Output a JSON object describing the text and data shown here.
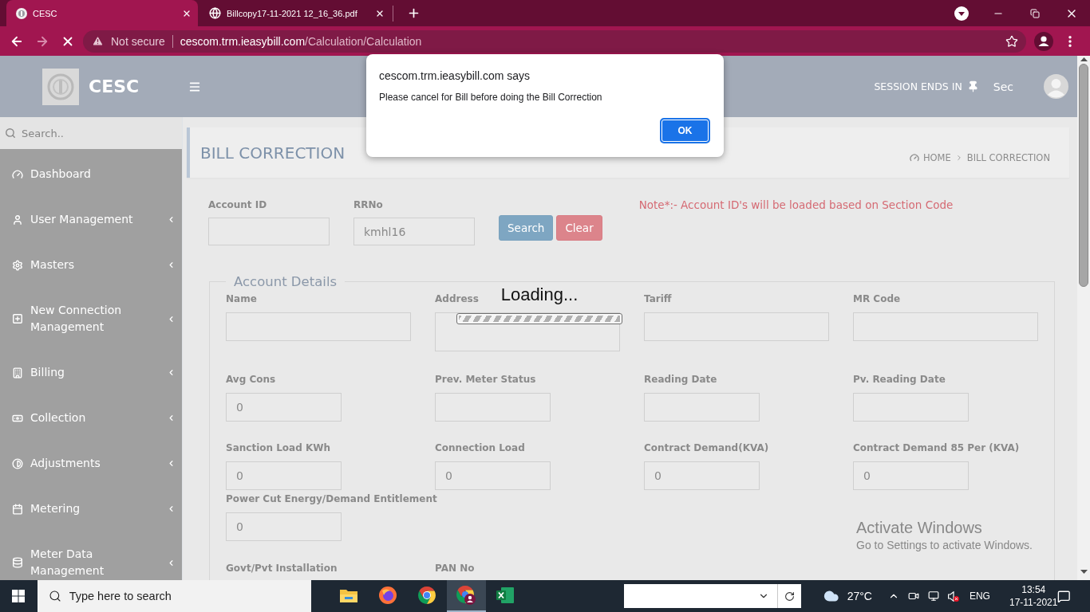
{
  "browser": {
    "tabs": [
      {
        "kind": "site",
        "title": "CESC",
        "selected": true
      },
      {
        "kind": "globe",
        "title": "Billcopy17-11-2021 12_16_36.pdf",
        "selected": false
      }
    ],
    "loading": true,
    "security_label": "Not secure",
    "url_host": "cescom.trm.ieasybill.com",
    "url_path": "/Calculation/Calculation"
  },
  "header": {
    "logo_text": "CESC",
    "session_label": "SESSION ENDS IN",
    "session_value": "Sec"
  },
  "sidebar": {
    "search_placeholder": "Search..",
    "items": [
      {
        "kind": "dashboard",
        "label": "Dashboard",
        "expandable": false
      },
      {
        "kind": "user",
        "label": "User Management",
        "expandable": true
      },
      {
        "kind": "gear",
        "label": "Masters",
        "expandable": true
      },
      {
        "kind": "plus",
        "label": "New Connection Management",
        "expandable": true
      },
      {
        "kind": "building",
        "label": "Billing",
        "expandable": true
      },
      {
        "kind": "money",
        "label": "Collection",
        "expandable": true
      },
      {
        "kind": "contrast",
        "label": "Adjustments",
        "expandable": true
      },
      {
        "kind": "calendar",
        "label": "Metering",
        "expandable": true
      },
      {
        "kind": "database",
        "label": "Meter Data Management",
        "expandable": true
      }
    ]
  },
  "page": {
    "title": "BILL CORRECTION",
    "breadcrumb": [
      "HOME",
      "BILL CORRECTION"
    ]
  },
  "search_form": {
    "fields": [
      {
        "label": "Account ID"
      },
      {
        "label": "RRNo",
        "value": "kmhl16"
      }
    ],
    "buttons": [
      {
        "kind": "primary",
        "label": "Search"
      },
      {
        "kind": "danger",
        "label": "Clear"
      }
    ],
    "note": "Note*:- Account ID's will be loaded based on Section Code"
  },
  "account_details": {
    "legend": "Account Details",
    "rows": [
      {
        "fields": [
          {
            "kind": "wide",
            "label": "Name"
          },
          {
            "kind": "textarea",
            "label": "Address"
          },
          {
            "kind": "wide",
            "label": "Tariff"
          },
          {
            "kind": "wide",
            "label": "MR Code"
          }
        ]
      },
      {
        "fields": [
          {
            "kind": "short",
            "label": "Avg Cons",
            "value": "0"
          },
          {
            "kind": "short",
            "label": "Prev. Meter Status"
          },
          {
            "kind": "short",
            "label": "Reading Date"
          },
          {
            "kind": "short",
            "label": "Pv. Reading Date"
          }
        ]
      },
      {
        "fields": [
          {
            "kind": "short",
            "label": "Sanction Load KWh",
            "value": "0"
          },
          {
            "kind": "short",
            "label": "Connection Load",
            "value": "0"
          },
          {
            "kind": "short",
            "label": "Contract Demand(KVA)",
            "value": "0"
          },
          {
            "kind": "short",
            "label": "Contract Demand 85 Per (KVA)",
            "value": "0"
          }
        ]
      },
      {
        "fields": [
          {
            "kind": "short",
            "label": "Power Cut Energy/Demand Entitlement",
            "value": "0"
          }
        ]
      },
      {
        "fields": [
          {
            "kind": "label",
            "label": "Govt/Pvt Installation"
          },
          {
            "kind": "label",
            "label": "PAN No"
          }
        ]
      }
    ]
  },
  "loading": {
    "text": "Loading...",
    "level": 1
  },
  "dialog": {
    "title": "cescom.trm.ieasybill.com says",
    "message": "Please cancel for Bill before doing the Bill Correction",
    "button": "OK"
  },
  "os_notice": {
    "title": "Activate Windows",
    "subtitle": "Go to Settings to activate Windows."
  },
  "taskbar": {
    "search_placeholder": "Type here to search",
    "apps": [
      {
        "kind": "explorer",
        "selected": false
      },
      {
        "kind": "firefox",
        "selected": false
      },
      {
        "kind": "chrome",
        "selected": false
      },
      {
        "kind": "chrome-profile",
        "selected": true
      },
      {
        "kind": "excel",
        "selected": false
      }
    ],
    "temperature": "27°C",
    "volume_muted": true,
    "language": "ENG",
    "time": "13:54",
    "date": "17-11-2021"
  }
}
